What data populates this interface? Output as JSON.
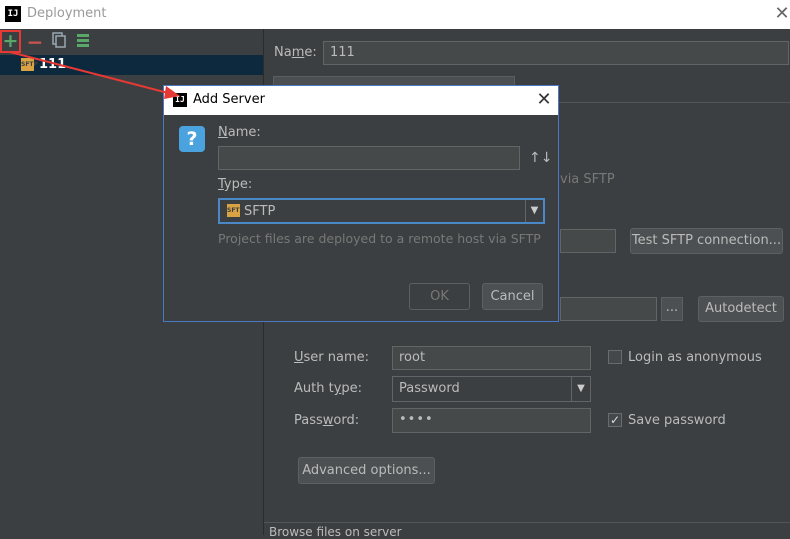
{
  "window": {
    "title": "Deployment",
    "app_icon_text": "IJ"
  },
  "toolbar": {
    "add": "+",
    "remove": "−",
    "copy": "⎘",
    "sync": "⇅"
  },
  "server_list": {
    "items": [
      {
        "label": "111",
        "icon": "sftp-icon",
        "icon_text": "SFTP"
      }
    ]
  },
  "details": {
    "name_label": "Name:",
    "name_value": "111",
    "type_desc_fragment": "via SFTP",
    "test_button": "Test SFTP connection...",
    "browse_button": "...",
    "autodetect_button": "Autodetect",
    "user_name_label": "User name:",
    "user_name_value": "root",
    "anonymous_label": "Login as anonymous",
    "anonymous_checked": false,
    "auth_type_label": "Auth type:",
    "auth_type_value": "Password",
    "password_label": "Password:",
    "password_value": "••••",
    "save_password_label": "Save password",
    "save_password_checked": true,
    "advanced_button": "Advanced options...",
    "browse_files_label": "Browse files on server"
  },
  "dialog": {
    "title": "Add Server",
    "app_icon_text": "IJ",
    "name_label": "Name:",
    "name_value": "",
    "type_label": "Type:",
    "type_value": "SFTP",
    "type_icon_text": "SFTP",
    "description": "Project files are deployed to a remote host via SFTP",
    "ok_button": "OK",
    "cancel_button": "Cancel",
    "sort_icon": "↑↓"
  },
  "colors": {
    "annotation": "#e53935",
    "accent": "#4a88c7",
    "background": "#3c3f41"
  }
}
